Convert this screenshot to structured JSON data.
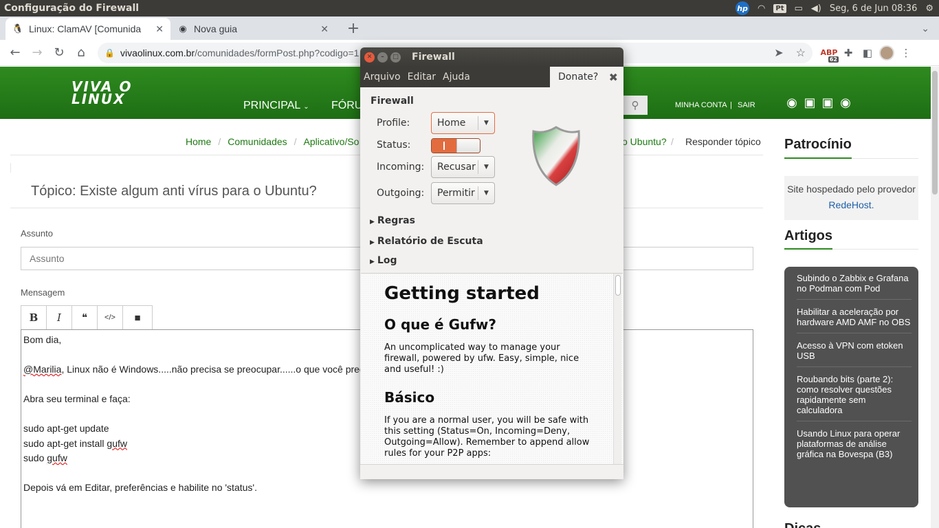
{
  "panel": {
    "title": "Configuração do Firewall",
    "keyboard": "Pt",
    "datetime": "Seg,  6 de Jun 08:36",
    "hp": "hp"
  },
  "browser": {
    "tabs": [
      {
        "label": "Linux: ClamAV [Comunida",
        "active": true
      },
      {
        "label": "Nova guia",
        "active": false
      }
    ],
    "url_host": "vivaolinux.com.br",
    "url_path": "/comunidades/formPost.php?codigo=1",
    "ext_badge": "62",
    "ext_abp": "ABP"
  },
  "site": {
    "logo_line1": "VIVA O",
    "logo_line2": "LINUX",
    "nav": {
      "principal": "PRINCIPAL",
      "forum": "FÓRU"
    },
    "account": {
      "minha_conta": "MINHA CONTA",
      "sep": "|",
      "sair": "SAIR"
    },
    "breadcrumb": {
      "home": "Home",
      "comunidades": "Comunidades",
      "aplicativo": "Aplicativo/So",
      "topic_tail": "o Ubuntu?",
      "current": "Responder tópico"
    },
    "topic_title": "Tópico: Existe algum anti vírus para o Ubuntu?",
    "subject_label": "Assunto",
    "subject_placeholder": "Assunto",
    "message_label": "Mensagem",
    "editor": {
      "bold": "B",
      "italic": "I",
      "quote": "❝",
      "code": "</>",
      "video": "■"
    },
    "message_lines": {
      "l1": "Bom dia,",
      "l3_user": "@Marilia",
      "l3_rest": ", Linux não é Windows.....não precisa se preocupar......o que você prec",
      "l5": "Abra seu terminal e faça:",
      "l7": "sudo apt-get update",
      "l8_pre": "sudo apt-get install ",
      "l8_pkg": "gufw",
      "l9_pre": "sudo ",
      "l9_pkg": "gufw",
      "l11": "Depois vá em Editar, preferências e habilite no 'status'."
    },
    "sidebar": {
      "sponsor_title": "Patrocínio",
      "sponsor_text": "Site hospedado pelo provedor",
      "sponsor_link": "RedeHost.",
      "articles_title": "Artigos",
      "articles": [
        "Subindo o Zabbix e Grafana no Podman com Pod",
        "Habilitar a aceleração por hardware AMD AMF no OBS",
        "Acesso à VPN com etoken USB",
        "Roubando bits (parte 2): como resolver questões rapidamente sem calculadora",
        "Usando Linux para operar plataformas de análise gráfica na Bovespa (B3)"
      ],
      "dicas_title": "Dicas"
    }
  },
  "gufw": {
    "window_title": "Firewall",
    "menu": {
      "arquivo": "Arquivo",
      "editar": "Editar",
      "ajuda": "Ajuda"
    },
    "donate": "Donate?",
    "section": "Firewall",
    "profile_label": "Profile:",
    "profile_value": "Home",
    "status_label": "Status:",
    "status_on": true,
    "incoming_label": "Incoming:",
    "incoming_value": "Recusar",
    "outgoing_label": "Outgoing:",
    "outgoing_value": "Permitir",
    "expanders": {
      "rules": "Regras",
      "listening": "Relatório de Escuta",
      "log": "Log"
    },
    "help": {
      "h1": "Getting started",
      "h2a": "O que é Gufw?",
      "p1": "An uncomplicated way to manage your firewall, powered by ufw. Easy, simple, nice and useful! :)",
      "h2b": "Básico",
      "p2": "If you are a normal user, you will be safe with this setting (Status=On, Incoming=Deny, Outgoing=Allow). Remember to append allow rules for your P2P apps:"
    }
  }
}
